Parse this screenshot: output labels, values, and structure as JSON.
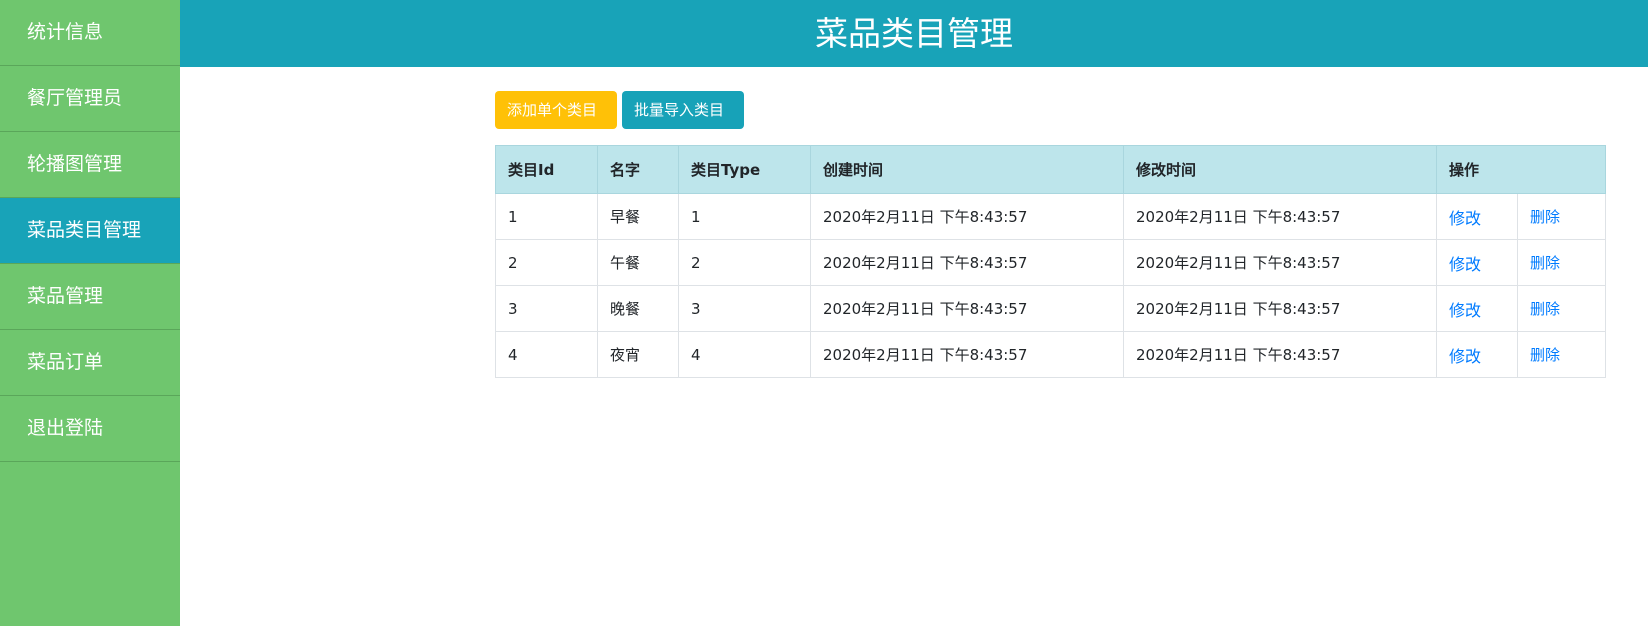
{
  "sidebar": {
    "items": [
      {
        "label": "统计信息"
      },
      {
        "label": "餐厅管理员"
      },
      {
        "label": "轮播图管理"
      },
      {
        "label": "菜品类目管理"
      },
      {
        "label": "菜品管理"
      },
      {
        "label": "菜品订单"
      },
      {
        "label": "退出登陆"
      }
    ],
    "active_index": 3
  },
  "header": {
    "title": "菜品类目管理"
  },
  "toolbar": {
    "add_label": "添加单个类目",
    "import_label": "批量导入类目"
  },
  "table": {
    "headers": {
      "id": "类目Id",
      "name": "名字",
      "type": "类目Type",
      "created": "创建时间",
      "modified": "修改时间",
      "actions": "操作"
    },
    "rows": [
      {
        "id": "1",
        "name": "早餐",
        "type": "1",
        "created": "2020年2月11日 下午8:43:57",
        "modified": "2020年2月11日 下午8:43:57",
        "edit": "修改",
        "delete": "删除"
      },
      {
        "id": "2",
        "name": "午餐",
        "type": "2",
        "created": "2020年2月11日 下午8:43:57",
        "modified": "2020年2月11日 下午8:43:57",
        "edit": "修改",
        "delete": "删除"
      },
      {
        "id": "3",
        "name": "晚餐",
        "type": "3",
        "created": "2020年2月11日 下午8:43:57",
        "modified": "2020年2月11日 下午8:43:57",
        "edit": "修改",
        "delete": "删除"
      },
      {
        "id": "4",
        "name": "夜宵",
        "type": "4",
        "created": "2020年2月11日 下午8:43:57",
        "modified": "2020年2月11日 下午8:43:57",
        "edit": "修改",
        "delete": "删除"
      }
    ]
  },
  "colors": {
    "sidebar": "#6fc66e",
    "accent": "#18a3b8",
    "warning": "#ffc107",
    "link": "#007bff",
    "table_header": "#bde5eb"
  }
}
